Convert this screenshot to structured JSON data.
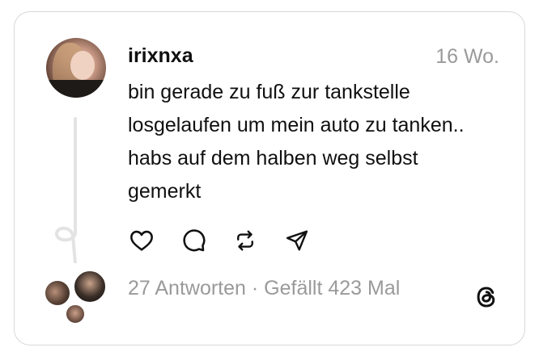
{
  "post": {
    "username": "irixnxa",
    "timestamp": "16 Wo.",
    "text": "bin gerade zu fuß zur tankstelle losgelaufen um mein auto zu tanken.. habs auf dem halben weg selbst gemerkt",
    "actions": [
      "heart-icon",
      "comment-icon",
      "repost-icon",
      "share-icon"
    ],
    "stats": "27 Antworten · Gefällt 423 Mal",
    "logo": "threads-logo-icon"
  },
  "colors": {
    "text": "#101010",
    "muted": "#9a9a9a",
    "border": "#d8d8d8",
    "thread_line": "#e3e3e3"
  }
}
